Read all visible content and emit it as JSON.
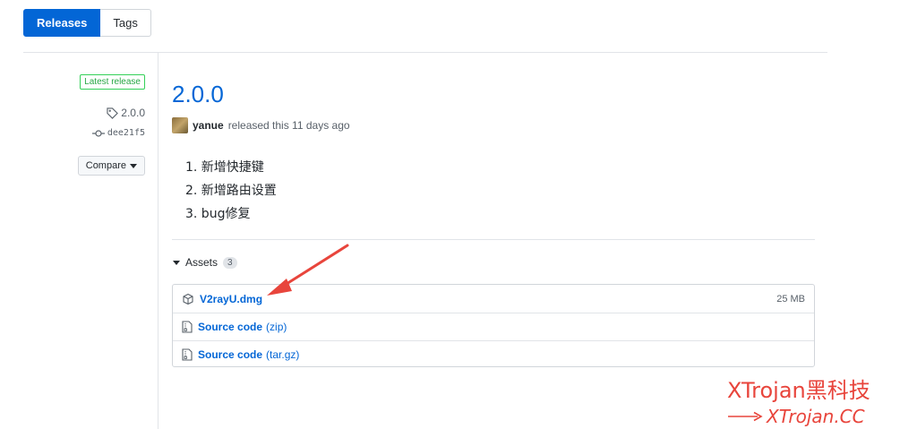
{
  "tabs": [
    {
      "label": "Releases",
      "selected": true
    },
    {
      "label": "Tags",
      "selected": false
    }
  ],
  "sidebar": {
    "latest_label": "Latest release",
    "tag": "2.0.0",
    "commit": "dee21f5",
    "compare_label": "Compare"
  },
  "release": {
    "title": "2.0.0",
    "author": "yanue",
    "released_text": "released this 11 days ago",
    "notes": [
      "1. 新增快捷键",
      "2. 新增路由设置",
      "3. bug修复"
    ]
  },
  "assets": {
    "label": "Assets",
    "count": "3",
    "items": [
      {
        "name": "V2rayU.dmg",
        "suffix": "",
        "size": "25 MB",
        "icon": "package-icon"
      },
      {
        "name": "Source code",
        "suffix": "(zip)",
        "size": "",
        "icon": "file-zip-icon"
      },
      {
        "name": "Source code",
        "suffix": "(tar.gz)",
        "size": "",
        "icon": "file-zip-icon"
      }
    ]
  },
  "watermark": {
    "line1": "XTrojan黑科技",
    "line2": "XTrojan.CC"
  },
  "colors": {
    "accent": "#0366d6",
    "success": "#28a745",
    "annotation": "#e8453c"
  }
}
